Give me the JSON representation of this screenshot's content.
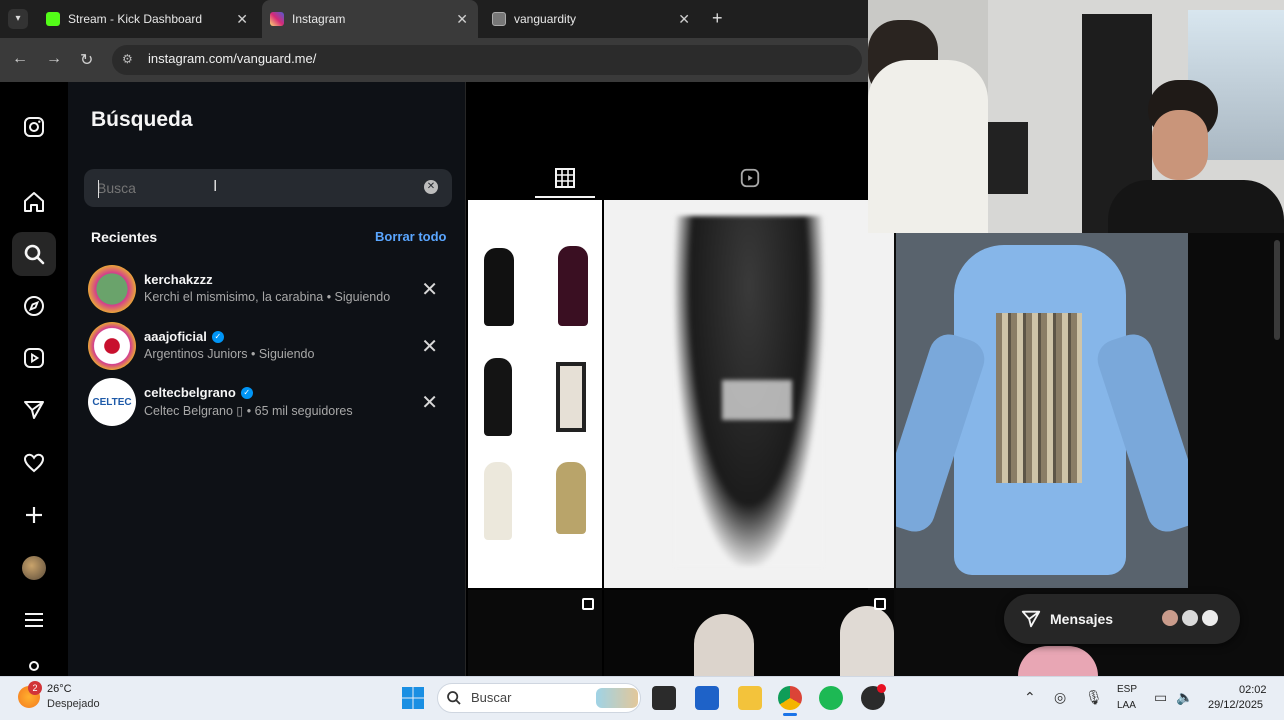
{
  "browser": {
    "tabs": [
      {
        "title": "Stream - Kick Dashboard",
        "icon": "kick-icon",
        "color": "#53fc18"
      },
      {
        "title": "Instagram",
        "icon": "instagram-icon",
        "color": "#e1306c",
        "active": true
      },
      {
        "title": "vanguardity",
        "icon": "site-icon",
        "color": "#888888"
      }
    ],
    "url": "instagram.com/vanguard.me/"
  },
  "search_panel": {
    "title": "Búsqueda",
    "placeholder": "Busca",
    "recent_label": "Recientes",
    "clear_all_label": "Borrar todo",
    "recents": [
      {
        "name": "kerchakzzz",
        "subtitle": "Kerchi el mismisimo, la carabina • Siguiendo",
        "verified": false,
        "avatar_color": "#d23c8f"
      },
      {
        "name": "aaajoficial",
        "subtitle": "Argentinos Juniors • Siguiendo",
        "verified": true,
        "avatar_color": "#c8102e"
      },
      {
        "name": "celtecbelgrano",
        "subtitle": "Celtec Belgrano ▯ • 65 mil seguidores",
        "verified": true,
        "avatar_color": "#1e5aa8",
        "avatar_text": "CELTEC"
      }
    ]
  },
  "messages": {
    "label": "Mensajes"
  },
  "taskbar": {
    "weather_temp": "26°C",
    "weather_cond": "Despejado",
    "weather_badge": "2",
    "search_label": "Buscar",
    "lang_1": "ESP",
    "lang_2": "LAA",
    "time": "02:02",
    "date": "29/12/2025"
  }
}
